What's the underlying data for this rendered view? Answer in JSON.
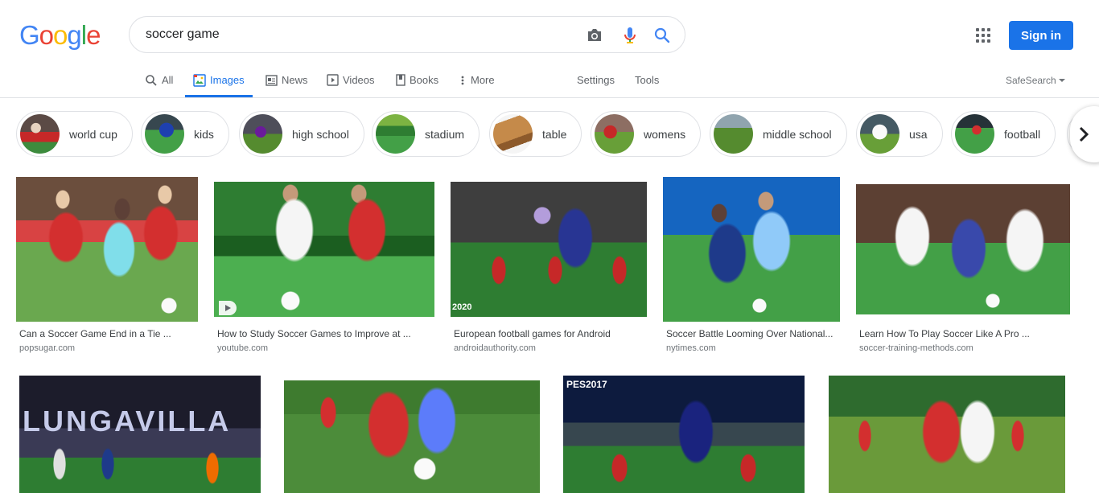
{
  "logo": {
    "letters": [
      "G",
      "o",
      "o",
      "g",
      "l",
      "e"
    ]
  },
  "search": {
    "query": "soccer game"
  },
  "header": {
    "signin_label": "Sign in"
  },
  "tabs": {
    "all": "All",
    "images": "Images",
    "news": "News",
    "videos": "Videos",
    "books": "Books",
    "more": "More",
    "settings": "Settings",
    "tools": "Tools",
    "safesearch": "SafeSearch"
  },
  "chips": [
    "world cup",
    "kids",
    "high school",
    "stadium",
    "table",
    "womens",
    "middle school",
    "usa",
    "football"
  ],
  "results": [
    {
      "title": "Can a Soccer Game End in a Tie ...",
      "source": "popsugar.com"
    },
    {
      "title": "How to Study Soccer Games to Improve at ...",
      "source": "youtube.com"
    },
    {
      "title": "European football games for Android",
      "source": "androidauthority.com",
      "overlay": "2020"
    },
    {
      "title": "Soccer Battle Looming Over National...",
      "source": "nytimes.com"
    },
    {
      "title": "Learn How To Play Soccer Like A Pro ...",
      "source": "soccer-training-methods.com"
    },
    {
      "title": "",
      "source": "",
      "overlay": "LUNGAVILLA"
    },
    {
      "title": "",
      "source": ""
    },
    {
      "title": "",
      "source": "",
      "overlay": "PES2017"
    },
    {
      "title": "",
      "source": ""
    }
  ],
  "colors": {
    "accent": "#1a73e8",
    "grass": "#4a8a2e",
    "red_kit": "#d32f2f",
    "blue_kit": "#1e3a8a"
  }
}
